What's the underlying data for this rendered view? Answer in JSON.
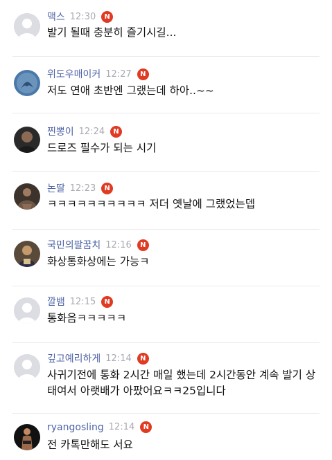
{
  "comments": [
    {
      "nickname": "맥스",
      "time": "12:30",
      "badge": "N",
      "text": "발기 될때 충분히 즐기시길..."
    },
    {
      "nickname": "위도우매이커",
      "time": "12:27",
      "badge": "N",
      "text": "저도 연애 초반엔 그랬는데 하아..~~"
    },
    {
      "nickname": "찐뽕이",
      "time": "12:24",
      "badge": "N",
      "text": "드로즈 필수가 되는 시기"
    },
    {
      "nickname": "논딸",
      "time": "12:23",
      "badge": "N",
      "text": "ㅋㅋㅋㅋㅋㅋㅋㅋㅋㅋ 저더 옛날에 그랬었는뎁"
    },
    {
      "nickname": "국민의팔꿈치",
      "time": "12:16",
      "badge": "N",
      "text": "화상통화상에는 가능ㅋ"
    },
    {
      "nickname": "깔뱀",
      "time": "12:15",
      "badge": "N",
      "text": "통화음ㅋㅋㅋㅋㅋ"
    },
    {
      "nickname": "깊고예리하게",
      "time": "12:14",
      "badge": "N",
      "text": "사귀기전에 통화 2시간 매일 했는데 2시간동안 계속 발기 상태여서 아랫배가 아팠어요ㅋㅋ25입니다"
    },
    {
      "nickname": "ryangosling",
      "time": "12:14",
      "badge": "N",
      "text": "전 카톡만해도 서요"
    }
  ],
  "colors": {
    "nickname": "#4e63a6",
    "timestamp": "#a9aab3",
    "badge": "#e03a22",
    "text": "#111111",
    "divider": "#e9e9ee"
  },
  "icons": [
    "default-avatar-icon",
    "photo-avatar-icon",
    "new-badge-icon"
  ]
}
